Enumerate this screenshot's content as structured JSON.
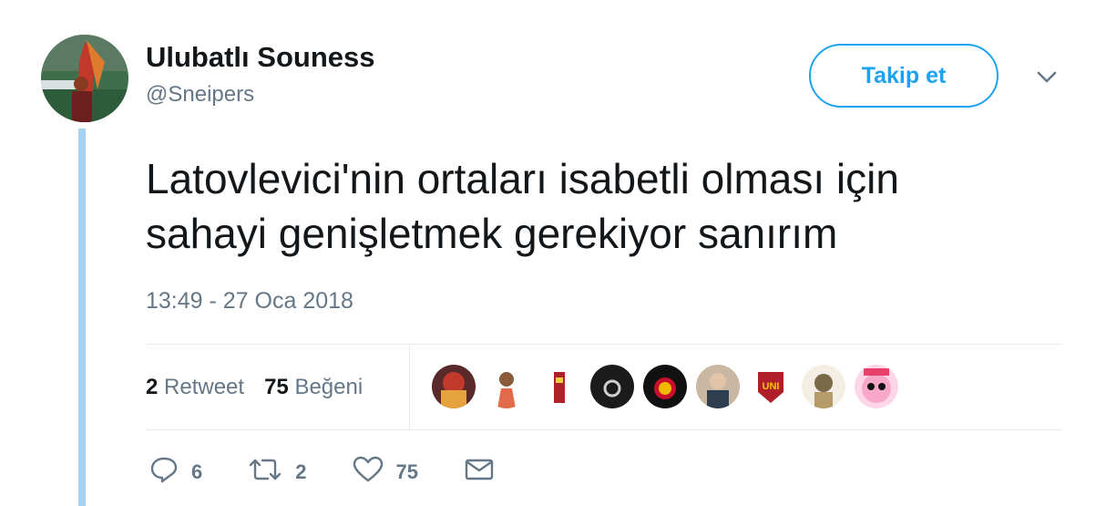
{
  "author": {
    "name": "Ulubatlı Souness",
    "handle": "@Sneipers"
  },
  "follow_label": "Takip et",
  "tweet": {
    "text_line1": "Latovlevici'nin ortaları isabetli olması için",
    "text_line2": "sahayi genişletmek gerekiyor sanırım",
    "timestamp": "13:49 - 27 Oca 2018"
  },
  "stats": {
    "retweet_count": "2",
    "retweet_label": "Retweet",
    "like_count": "75",
    "like_label": "Beğeni"
  },
  "actions": {
    "reply_count": "6",
    "retweet_count": "2",
    "like_count": "75"
  },
  "liker_badge_text": "UNI",
  "colors": {
    "accent": "#1da1f2",
    "thread_line": "#a4d2f1",
    "muted": "#657786",
    "text": "#14171a"
  },
  "icons": [
    "chevron-down-icon",
    "reply-icon",
    "retweet-icon",
    "heart-icon",
    "envelope-icon"
  ]
}
